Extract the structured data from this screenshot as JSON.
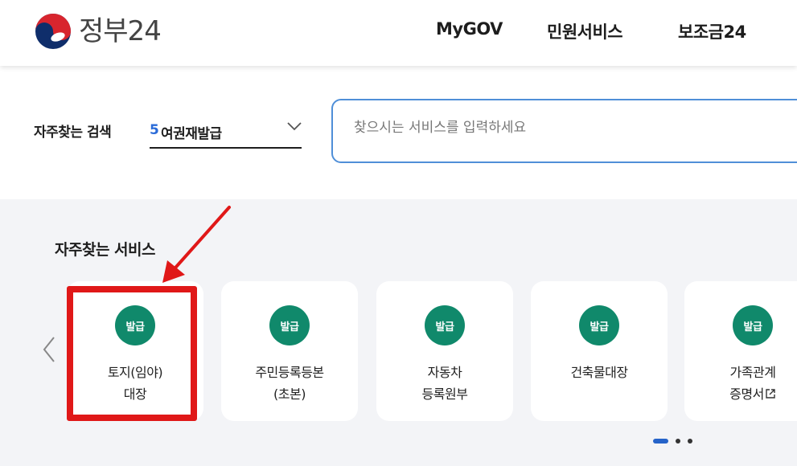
{
  "header": {
    "logo_text": "정부24",
    "nav": [
      "MyGOV",
      "민원서비스",
      "보조금24"
    ]
  },
  "search": {
    "faq_label": "자주찾는 검색",
    "selected_rank": "5",
    "selected_value": "여권재발급",
    "placeholder": "찾으시는 서비스를 입력하세요"
  },
  "services": {
    "title": "자주찾는 서비스",
    "cards": [
      {
        "badge": "발급",
        "lines": [
          "토지(임야)",
          "대장"
        ],
        "external": false
      },
      {
        "badge": "발급",
        "lines": [
          "주민등록등본",
          "(초본)"
        ],
        "external": false
      },
      {
        "badge": "발급",
        "lines": [
          "자동차",
          "등록원부"
        ],
        "external": false
      },
      {
        "badge": "발급",
        "lines": [
          "건축물대장"
        ],
        "external": false
      },
      {
        "badge": "발급",
        "lines": [
          "가족관계",
          "증명서"
        ],
        "external": true
      }
    ]
  },
  "colors": {
    "badge_green": "#10896b",
    "highlight_red": "#e01818",
    "search_border": "#4f8fd8",
    "accent_blue": "#2563c9"
  },
  "pagination": {
    "active_index": 0,
    "total": 3
  }
}
